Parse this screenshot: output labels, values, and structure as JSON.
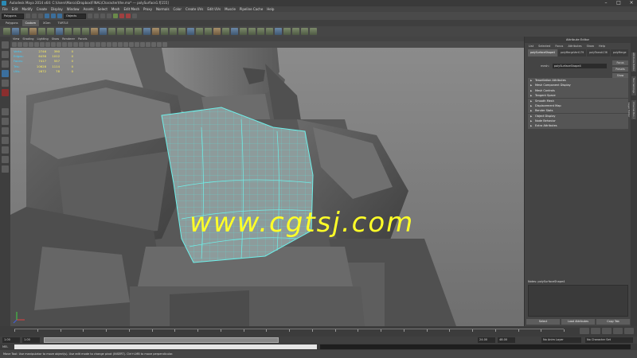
{
  "window": {
    "title": "Autodesk Maya 2014 x64: C:\\Users\\Marco\\Dropbox\\FINAL\\Character\\the.ma* --- polySurface1.f[155]"
  },
  "menubar": {
    "items": [
      "File",
      "Edit",
      "Modify",
      "Create",
      "Display",
      "Window",
      "Assets",
      "Select",
      "Mesh",
      "Edit Mesh",
      "Proxy",
      "Normals",
      "Color",
      "Create UVs",
      "Edit UVs",
      "Muscle",
      "Pipeline Cache",
      "Help"
    ]
  },
  "statusline": {
    "mode": "Polygons",
    "objects_label": "Objects"
  },
  "shelf": {
    "tabs": [
      "Polygons",
      "Custom",
      "XGen",
      "TURTLE"
    ],
    "active_tab": "Custom"
  },
  "panel": {
    "menu": [
      "View",
      "Shading",
      "Lighting",
      "Show",
      "Renderer",
      "Panels"
    ]
  },
  "hud": {
    "rows": [
      {
        "label": "Verts:",
        "values": [
          "2746",
          "390",
          "0"
        ]
      },
      {
        "label": "Edges:",
        "values": [
          "6436",
          "1012",
          "0"
        ]
      },
      {
        "label": "Faces:",
        "values": [
          "7417",
          "557",
          "0"
        ]
      },
      {
        "label": "Tris:",
        "values": [
          "10628",
          "1114",
          "0"
        ]
      },
      {
        "label": "UVs:",
        "values": [
          "2872",
          "78",
          "0"
        ]
      }
    ]
  },
  "watermark": {
    "text": "www.cgtsj.com"
  },
  "attribute_editor": {
    "title": "Attribute Editor",
    "menu": [
      "List",
      "Selected",
      "Focus",
      "Attributes",
      "Show",
      "Help"
    ],
    "tabs": [
      "polySurfaceShape4",
      "polyMergeVert179",
      "polyTweak136",
      "polyMerge"
    ],
    "node_label": "mesh:",
    "node_value": "polySurfaceShape4",
    "buttons": [
      "Focus",
      "Presets",
      "Show",
      "Hide"
    ],
    "sections": [
      "Tessellation Attributes",
      "Mesh Component Display",
      "Mesh Controls",
      "Tangent Space",
      "Smooth Mesh",
      "Displacement Map",
      "Render Stats",
      "Object Display",
      "Node Behavior",
      "Extra Attributes"
    ],
    "notes_label": "Notes: polySurfaceShape4",
    "bottom_buttons": [
      "Select",
      "Load Attributes",
      "Copy Tab"
    ]
  },
  "side_tabs": [
    "Attribute Editor",
    "Tool Settings",
    "Channel Box / Layer Editor"
  ],
  "timeslider": {
    "start": "1.00",
    "end_marker": "24"
  },
  "range": {
    "start": "1.00",
    "inner_start": "1.00",
    "mid": "24",
    "end": "24.00",
    "max": "48.00",
    "anim_layer": "No Anim Layer",
    "char_set": "No Character Set"
  },
  "cmdline": {
    "label": "MEL"
  },
  "helpline": {
    "text": "Move Tool: Use manipulator to move object(s). Use edit mode to change pivot (INSERT). Ctrl+LMB to move perpendicular."
  }
}
